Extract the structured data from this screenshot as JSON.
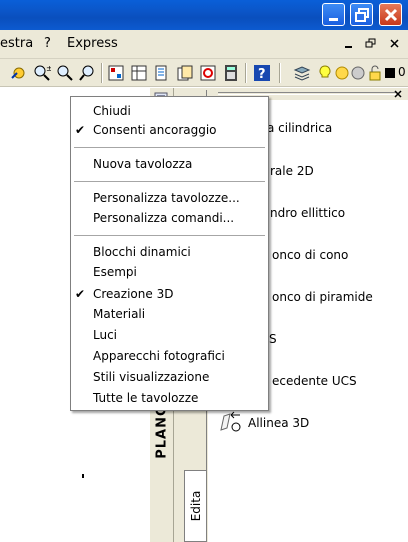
{
  "menubar": {
    "items": [
      "estra",
      "?",
      "Express"
    ]
  },
  "context_menu": {
    "items": [
      {
        "label": "Chiudi",
        "checked": false
      },
      {
        "label": "Consenti ancoraggio",
        "checked": true
      },
      {
        "label": "Nuova tavolozza",
        "checked": false
      },
      {
        "label": "Personalizza tavolozze...",
        "checked": false
      },
      {
        "label": "Personalizza comandi...",
        "checked": false
      },
      {
        "label": "Blocchi dinamici",
        "checked": false
      },
      {
        "label": "Esempi",
        "checked": false
      },
      {
        "label": "Creazione 3D",
        "checked": true
      },
      {
        "label": "Materiali",
        "checked": false
      },
      {
        "label": "Luci",
        "checked": false
      },
      {
        "label": "Apparecchi fotografici",
        "checked": false
      },
      {
        "label": "Stili visualizzazione",
        "checked": false
      },
      {
        "label": "Tutte le tavolozze",
        "checked": false
      }
    ],
    "check_glyph": "✔"
  },
  "palette": {
    "strip_title": "PLANCIA D",
    "tab_label": "Edita",
    "items": [
      "a cilindrica",
      "rale 2D",
      "ndro ellittico",
      "onco di cono",
      "onco di piramide",
      "S",
      "ecedente UCS",
      "Allinea 3D"
    ]
  },
  "colors": {
    "titlebar": "#0a5fd8",
    "close_button": "#c8381a",
    "chrome": "#ece9d8"
  }
}
